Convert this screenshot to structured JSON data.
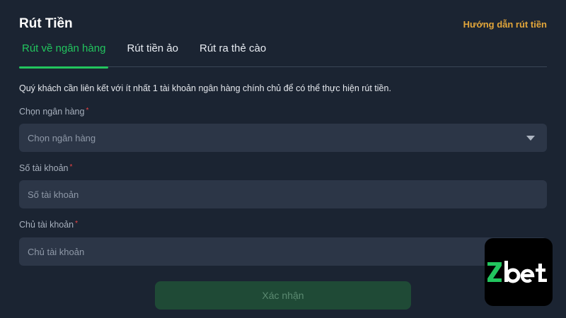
{
  "header": {
    "title": "Rút Tiền",
    "guide_link": "Hướng dẫn rút tiền"
  },
  "tabs": [
    {
      "label": "Rút về ngân hàng",
      "active": true
    },
    {
      "label": "Rút tiền ảo",
      "active": false
    },
    {
      "label": "Rút ra thẻ cào",
      "active": false
    }
  ],
  "notice": "Quý khách cần liên kết với ít nhất 1 tài khoản ngân hàng chính chủ để có thể thực hiện rút tiền.",
  "form": {
    "bank": {
      "label": "Chọn ngân hàng",
      "placeholder": "Chọn ngân hàng",
      "required_mark": "*"
    },
    "account_number": {
      "label": "Số tài khoản",
      "placeholder": "Số tài khoản",
      "required_mark": "*"
    },
    "account_holder": {
      "label": "Chủ tài khoản",
      "placeholder": "Chủ tài khoản",
      "required_mark": "*"
    },
    "submit_label": "Xác nhận"
  },
  "logo": {
    "text": "Zbet"
  },
  "colors": {
    "background": "#1b2432",
    "accent_green": "#22c55e",
    "link_orange": "#e3a63a",
    "required_red": "#ef4444",
    "input_bg": "#2c3647",
    "button_bg": "#1f4a36"
  }
}
